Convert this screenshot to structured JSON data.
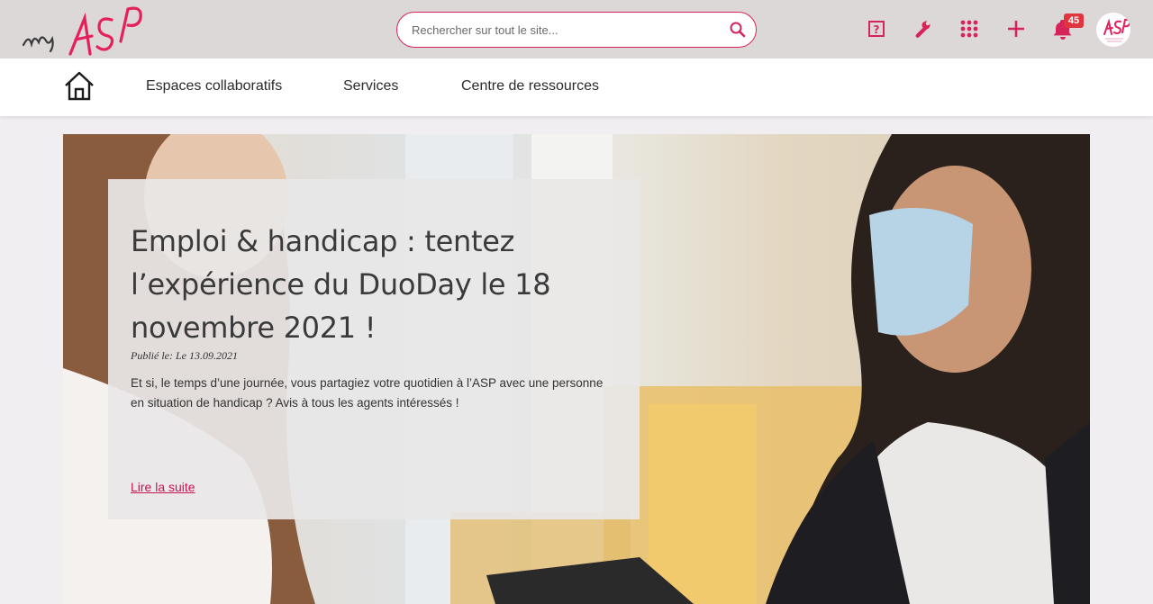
{
  "header": {
    "logo_text": "myASP",
    "search": {
      "placeholder": "Rechercher sur tout le site...",
      "value": ""
    },
    "notifications_count": "45",
    "avatar_text": "ASP",
    "accent_color": "#d6245a"
  },
  "nav": {
    "items": [
      {
        "label": "Espaces collaboratifs"
      },
      {
        "label": "Services"
      },
      {
        "label": "Centre de ressources"
      }
    ]
  },
  "hero": {
    "title": "Emploi & handicap : tentez l’expérience du DuoDay le 18 novembre 2021 !",
    "date": "Publié le: Le 13.09.2021",
    "excerpt": "Et si, le temps d’une journée, vous partagiez votre quotidien à l’ASP avec une personne en situation de handicap ? Avis à tous les agents intéressés !",
    "read_more": "Lire la suite"
  },
  "icons": [
    "help-icon",
    "wrench-icon",
    "apps-grid-icon",
    "plus-icon",
    "bell-icon",
    "search-icon",
    "home-icon"
  ]
}
